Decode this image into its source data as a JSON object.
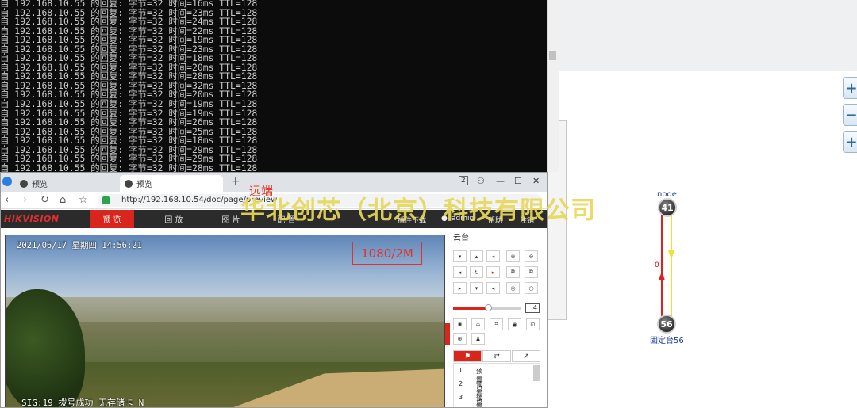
{
  "console": {
    "lines": [
      "自 192.168.10.55 的回复: 字节=32 时间=16ms TTL=128",
      "自 192.168.10.55 的回复: 字节=32 时间=23ms TTL=128",
      "自 192.168.10.55 的回复: 字节=32 时间=24ms TTL=128",
      "自 192.168.10.55 的回复: 字节=32 时间=22ms TTL=128",
      "自 192.168.10.55 的回复: 字节=32 时间=19ms TTL=128",
      "自 192.168.10.55 的回复: 字节=32 时间=23ms TTL=128",
      "自 192.168.10.55 的回复: 字节=32 时间=18ms TTL=128",
      "自 192.168.10.55 的回复: 字节=32 时间=20ms TTL=128",
      "自 192.168.10.55 的回复: 字节=32 时间=28ms TTL=128",
      "自 192.168.10.55 的回复: 字节=32 时间=32ms TTL=128",
      "自 192.168.10.55 的回复: 字节=32 时间=20ms TTL=128",
      "自 192.168.10.55 的回复: 字节=32 时间=19ms TTL=128",
      "自 192.168.10.55 的回复: 字节=32 时间=19ms TTL=128",
      "自 192.168.10.55 的回复: 字节=32 时间=26ms TTL=128",
      "自 192.168.10.55 的回复: 字节=32 时间=25ms TTL=128",
      "自 192.168.10.55 的回复: 字节=32 时间=18ms TTL=128",
      "自 192.168.10.55 的回复: 字节=32 时间=29ms TTL=128",
      "自 192.168.10.55 的回复: 字节=32 时间=29ms TTL=128",
      "自 192.168.10.55 的回复: 字节=32 时间=28ms TTL=128"
    ]
  },
  "browser": {
    "tab1_label": "预览",
    "tab2_label": "预览",
    "new_tab": "+",
    "tab_count": "2",
    "url": "http://192.168.10.54/doc/page/preview",
    "minimize": "—",
    "maximize": "☐",
    "close": "✕"
  },
  "hik": {
    "logo": "HIKVISION",
    "nav": {
      "preview": "预 览",
      "playback": "回 放",
      "picture": "图 片",
      "config": "配 置"
    },
    "plugin_download": "插件下载",
    "user": "admin",
    "help": "帮助",
    "logout": "注销"
  },
  "video": {
    "osd_time": "2021/06/17  星期四  14:56:21",
    "resolution": "1080/2M",
    "osd_bottom": "SIG:19  拨号成功  无存储卡  N"
  },
  "ptz": {
    "title": "云台",
    "speed": "4",
    "presets": [
      {
        "num": "1",
        "name": "预置点 1"
      },
      {
        "num": "2",
        "name": "预置点 2"
      },
      {
        "num": "3",
        "name": "预置点 3"
      }
    ]
  },
  "overlay": {
    "remote_label": "远端",
    "company": "华北创芯（北京）科技有限公司"
  },
  "topology": {
    "top_label": "node",
    "node_top": "41",
    "node_bottom": "56",
    "node_bottom_label": "固定台56",
    "link_label": "0",
    "link_colors": {
      "up": "#e02020",
      "down": "#f2e03a"
    }
  }
}
